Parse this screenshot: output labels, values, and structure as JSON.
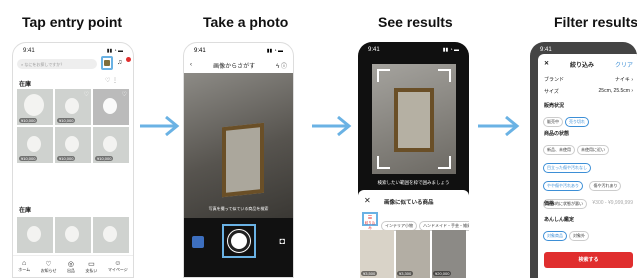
{
  "titles": [
    "Tap entry point",
    "Take a photo",
    "See results",
    "Filter results"
  ],
  "status_time": "9:41",
  "p1": {
    "search_placeholder": "なにをお探しですか？",
    "section": "在庫",
    "section2": "在庫",
    "price": "¥10,000",
    "tabs": [
      "ホーム",
      "お知らせ",
      "出品",
      "支払い",
      "マイページ"
    ]
  },
  "p2": {
    "header": "画像からさがす",
    "hint": "写真を撮って似ている商品を検索"
  },
  "p3": {
    "hint": "検索したい範囲を枠で囲みましょう",
    "sheet_title": "画像に似ている商品",
    "filter_label": "絞り込み",
    "cats": [
      "インテリア小物",
      "ハンドメイド・手芸・雑貨"
    ],
    "prices": [
      "¥3,500",
      "¥3,300",
      "¥20,000"
    ]
  },
  "p4": {
    "title": "絞り込み",
    "clear": "クリア",
    "brand": "ブランド",
    "brand_val": "ナイキ",
    "size": "サイズ",
    "size_val": "25cm, 25.5cm",
    "status": "販売状況",
    "status_chips": [
      "販売中",
      "売り切れ"
    ],
    "condition": "商品の状態",
    "cond_chips": [
      "新品、未使用",
      "未使用に近い",
      "目立った傷や汚れなし",
      "やや傷や汚れあり",
      "傷や汚れあり",
      "全体的に状態が悪い"
    ],
    "price": "価格",
    "price_val": "¥300 - ¥9,999,999",
    "shipping": "あんしん鑑定",
    "ship_chips": [
      "対象商品",
      "対象外"
    ],
    "button": "検索する"
  },
  "accent": "#e02e2e",
  "highlight": "#6ab2e4"
}
